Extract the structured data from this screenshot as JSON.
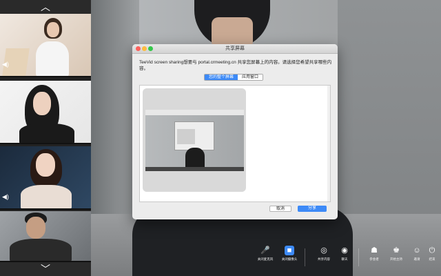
{
  "sidebar": {
    "up_arrow": "︿",
    "down_arrow": "﹀",
    "mic_indicator": "◀)"
  },
  "dialog": {
    "title": "共享屏幕",
    "message": "TeeVid screen sharing想要与 portal.crmeeting.cn 共享您屏幕上的内容。请选择您希望共享哪些内容。",
    "tabs": [
      {
        "label": "您的整个屏幕",
        "active": true
      },
      {
        "label": "应用窗口",
        "active": false
      }
    ],
    "cancel_label": "取消",
    "share_label": "分享"
  },
  "toolbar": {
    "items": [
      {
        "label": "关闭麦克风",
        "icon": "mic-icon"
      },
      {
        "label": "关闭摄像头",
        "icon": "camera-icon"
      },
      {
        "label": "共享内容",
        "icon": "share-screen-icon"
      },
      {
        "label": "聊天",
        "icon": "chat-icon"
      },
      {
        "label": "参会者",
        "icon": "participants-icon"
      },
      {
        "label": "开始主持",
        "icon": "host-icon"
      },
      {
        "label": "邀请",
        "icon": "invite-icon"
      },
      {
        "label": "结束",
        "icon": "power-icon"
      }
    ]
  },
  "colors": {
    "accent": "#3d8af7",
    "dialog_bg": "#ececec",
    "close": "#fc605c",
    "minimize": "#fdbc40",
    "maximize": "#34c84a"
  }
}
